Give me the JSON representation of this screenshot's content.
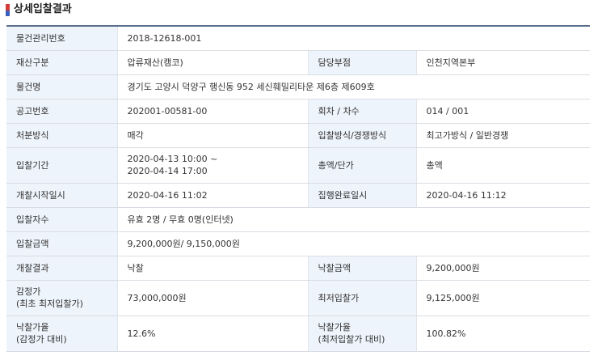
{
  "header": {
    "title": "상세입찰결과"
  },
  "rows": {
    "item_mgmt_no": {
      "label": "물건관리번호",
      "value": "2018-12618-001"
    },
    "asset_type": {
      "label": "재산구분",
      "value": "압류재산(캠코)"
    },
    "department": {
      "label": "담당부점",
      "value": "인천지역본부"
    },
    "item_name": {
      "label": "물건명",
      "value": "경기도 고양시 덕양구 행신동 952 세신훼밀리타운 제6층 제609호"
    },
    "notice_no": {
      "label": "공고번호",
      "value": "202001-00581-00"
    },
    "round": {
      "label": "회차 / 차수",
      "value": "014 / 001"
    },
    "disposal_method": {
      "label": "처분방식",
      "value": "매각"
    },
    "bid_method": {
      "label": "입찰방식/경쟁방식",
      "value": "최고가방식 / 일반경쟁"
    },
    "bid_period": {
      "label": "입찰기간",
      "value_start": "2020-04-13 10:00 ~",
      "value_end": "2020-04-14 17:00"
    },
    "total_unit": {
      "label": "총액/단가",
      "value": "총액"
    },
    "opening_start": {
      "label": "개찰시작일시",
      "value": "2020-04-16 11:02"
    },
    "execution_done": {
      "label": "집행완료일시",
      "value": "2020-04-16 11:12"
    },
    "bidder_count": {
      "label": "입찰자수",
      "value": "유효 2명 / 무효 0명(인터넷)"
    },
    "bid_amount": {
      "label": "입찰금액",
      "value": "9,200,000원/ 9,150,000원"
    },
    "opening_result": {
      "label": "개찰결과",
      "value": "낙찰"
    },
    "winning_amount": {
      "label": "낙찰금액",
      "value": "9,200,000원"
    },
    "appraisal": {
      "label_line1": "감정가",
      "label_line2": "(최초 최저입찰가)",
      "value": "73,000,000원"
    },
    "min_bid": {
      "label": "최저입찰가",
      "value": "9,125,000원"
    },
    "ratio_appraisal": {
      "label_line1": "낙찰가율",
      "label_line2": "(감정가 대비)",
      "value": "12.6%"
    },
    "ratio_min_bid": {
      "label_line1": "낙찰가율",
      "label_line2": "(최저입찰가 대비)",
      "value": "100.82%"
    }
  }
}
